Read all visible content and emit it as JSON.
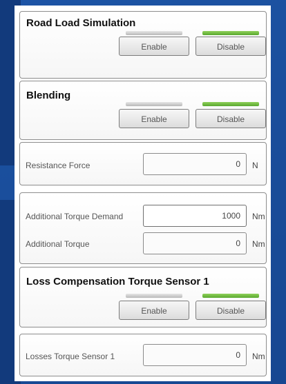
{
  "enable_label": "Enable",
  "disable_label": "Disable",
  "groups": {
    "road_load": {
      "title": "Road Load Simulation"
    },
    "blending": {
      "title": "Blending"
    },
    "loss_comp": {
      "title": "Loss Compensation Torque Sensor 1"
    }
  },
  "fields": {
    "resistance_force": {
      "label": "Resistance Force",
      "value": "0",
      "unit": "N"
    },
    "additional_torque_demand": {
      "label": "Additional Torque Demand",
      "value": "1000",
      "unit": "Nm"
    },
    "additional_torque": {
      "label": "Additional Torque",
      "value": "0",
      "unit": "Nm"
    },
    "losses_torque_sensor_1": {
      "label": "Losses Torque Sensor 1",
      "value": "0",
      "unit": "Nm"
    }
  },
  "indicators": {
    "enable_color": "#cfcfcf",
    "disable_color": "#6cbb3c"
  }
}
